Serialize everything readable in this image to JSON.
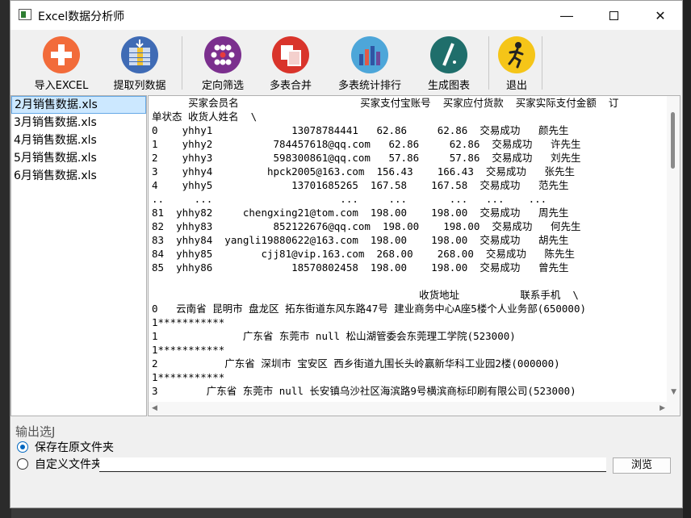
{
  "window": {
    "title": "Excel数据分析师"
  },
  "toolbar": [
    {
      "label": "导入EXCEL",
      "icon": "import-plus-icon",
      "color": "#f26b3a"
    },
    {
      "label": "提取列数据",
      "icon": "extract-column-icon",
      "color": "#3f6bb5"
    },
    {
      "label": "定向筛选",
      "icon": "filter-dots-icon",
      "color": "#7b2f8e"
    },
    {
      "label": "多表合并",
      "icon": "merge-sheets-icon",
      "color": "#d9342b"
    },
    {
      "label": "多表统计排行",
      "icon": "bar-chart-icon",
      "color": "#4da6d9"
    },
    {
      "label": "生成图表",
      "icon": "chart-pen-icon",
      "color": "#1f6e6b"
    },
    {
      "label": "退出",
      "icon": "exit-runner-icon",
      "color": "#f5c518"
    }
  ],
  "files": [
    "2月销售数据.xls",
    "3月销售数据.xls",
    "4月销售数据.xls",
    "5月销售数据.xls",
    "6月销售数据.xls"
  ],
  "selected_file_index": 0,
  "output_lines": [
    "      买家会员名                    买家支付宝账号  买家应付货款  买家实际支付金额  订",
    "单状态 收货人姓名  \\",
    "0    yhhy1             13078784441   62.86     62.86  交易成功   颜先生",
    "1    yhhy2          784457618@qq.com   62.86     62.86  交易成功   许先生",
    "2    yhhy3          598300861@qq.com   57.86     57.86  交易成功   刘先生",
    "3    yhhy4         hpck2005@163.com  156.43    166.43  交易成功   张先生",
    "4    yhhy5             13701685265  167.58    167.58  交易成功   范先生",
    "..     ...                     ...     ...       ...   ...    ...",
    "81  yhhy82     chengxing21@tom.com  198.00    198.00  交易成功   周先生",
    "82  yhhy83          852122676@qq.com  198.00    198.00  交易成功   何先生",
    "83  yhhy84  yangli19880622@163.com  198.00    198.00  交易成功   胡先生",
    "84  yhhy85        cjj81@vip.163.com  268.00    268.00  交易成功   陈先生",
    "85  yhhy86             18570802458  198.00    198.00  交易成功   曾先生",
    "",
    "                                            收货地址          联系手机  \\",
    "0   云南省 昆明市 盘龙区 拓东街道东风东路47号 建业商务中心A座5楼个人业务部(650000)",
    "1***********",
    "1              广东省 东莞市 null 松山湖管委会东莞理工学院(523000)",
    "1***********",
    "2           广东省 深圳市 宝安区 西乡街道九围长头岭赢新华科工业园2楼(000000)",
    "1***********",
    "3        广东省 东莞市 null 长安镇乌沙社区海滨路9号横滨商标印刷有限公司(523000)"
  ],
  "output_options": {
    "title": "输出选J",
    "option_original": "保存在原文件夹",
    "option_custom": "自定义文件夹",
    "selected": "original",
    "path_value": "",
    "browse_label": "浏览"
  }
}
